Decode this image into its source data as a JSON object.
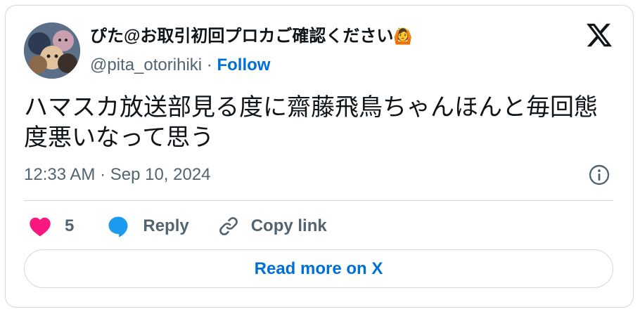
{
  "author": {
    "display_name": "ぴた@お取引初回プロカご確認ください",
    "name_emoji": "🙆",
    "handle": "@pita_otorihiki",
    "separator": "·",
    "follow_label": "Follow"
  },
  "tweet": {
    "text": "ハマスカ放送部見る度に齋藤飛鳥ちゃんほんと毎回態度悪いなって思う",
    "timestamp": "12:33 AM · Sep 10, 2024"
  },
  "actions": {
    "like_count": "5",
    "reply_label": "Reply",
    "copy_link_label": "Copy link"
  },
  "read_more_label": "Read more on X",
  "colors": {
    "like": "#f91880",
    "reply": "#1d9bf0",
    "link": "#006fd6",
    "secondary_text": "#536471",
    "primary_text": "#0f1419",
    "border": "#cfd9de"
  },
  "icons": [
    "x-logo-icon",
    "info-icon",
    "heart-icon",
    "reply-bubble-icon",
    "link-icon"
  ]
}
